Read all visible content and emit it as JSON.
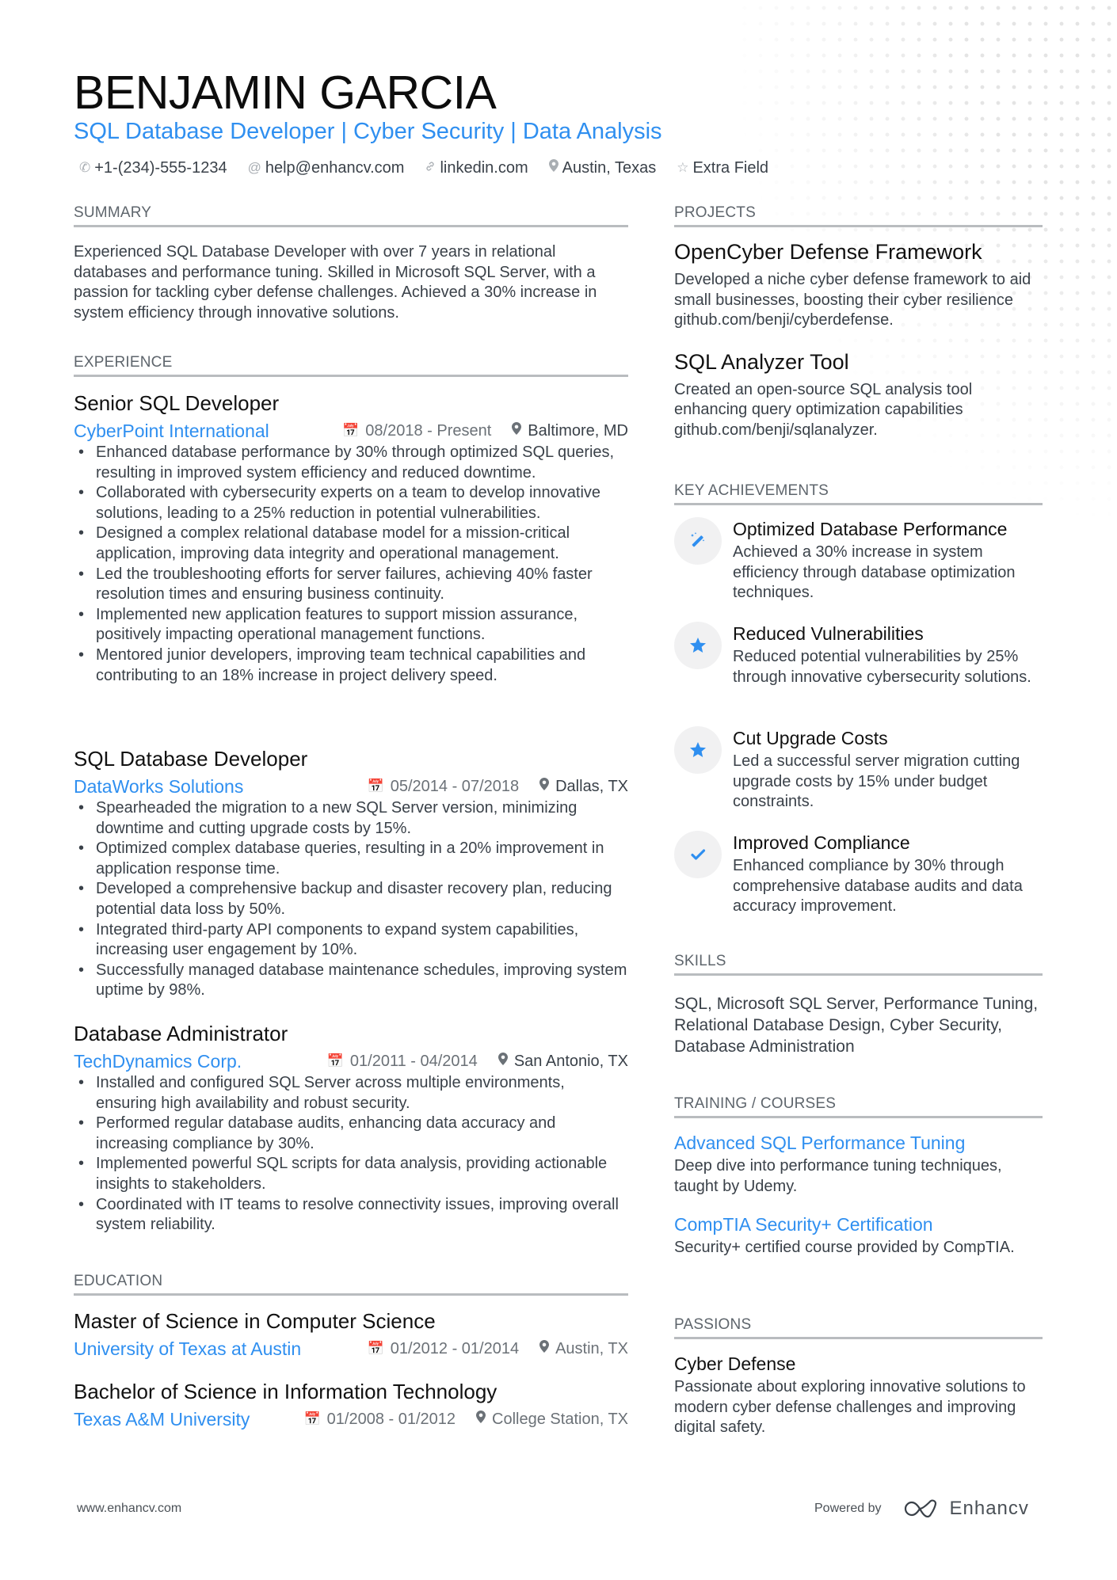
{
  "header": {
    "name": "BENJAMIN GARCIA",
    "headline": "SQL Database Developer | Cyber Security | Data Analysis",
    "contacts": [
      {
        "icon": "phone-icon",
        "text": "+1-(234)-555-1234"
      },
      {
        "icon": "at-icon",
        "text": "help@enhancv.com"
      },
      {
        "icon": "link-icon",
        "text": "linkedin.com"
      },
      {
        "icon": "location-pin-icon",
        "text": "Austin, Texas"
      },
      {
        "icon": "star-outline-icon",
        "text": "Extra Field"
      }
    ]
  },
  "summary": {
    "heading": "SUMMARY",
    "text": "Experienced SQL Database Developer with over 7 years in relational databases and performance tuning. Skilled in Microsoft SQL Server, with a passion for tackling cyber defense challenges. Achieved a 30% increase in system efficiency through innovative solutions."
  },
  "experience": {
    "heading": "EXPERIENCE",
    "jobs": [
      {
        "title": "Senior SQL Developer",
        "company": "CyberPoint International",
        "dates": "08/2018 - Present",
        "location": "Baltimore, MD",
        "bullets": [
          "Enhanced database performance by 30% through optimized SQL queries, resulting in improved system efficiency and reduced downtime.",
          "Collaborated with cybersecurity experts on a team to develop innovative solutions, leading to a 25% reduction in potential vulnerabilities.",
          "Designed a complex relational database model for a mission-critical application, improving data integrity and operational management.",
          "Led the troubleshooting efforts for server failures, achieving 40% faster resolution times and ensuring business continuity.",
          "Implemented new application features to support mission assurance, positively impacting operational management functions.",
          "Mentored junior developers, improving team technical capabilities and contributing to an 18% increase in project delivery speed."
        ]
      },
      {
        "title": "SQL Database Developer",
        "company": "DataWorks Solutions",
        "dates": "05/2014 - 07/2018",
        "location": "Dallas, TX",
        "bullets": [
          "Spearheaded the migration to a new SQL Server version, minimizing downtime and cutting upgrade costs by 15%.",
          "Optimized complex database queries, resulting in a 20% improvement in application response time.",
          "Developed a comprehensive backup and disaster recovery plan, reducing potential data loss by 50%.",
          "Integrated third-party API components to expand system capabilities, increasing user engagement by 10%.",
          "Successfully managed database maintenance schedules, improving system uptime by 98%."
        ]
      },
      {
        "title": "Database Administrator",
        "company": "TechDynamics Corp.",
        "dates": "01/2011 - 04/2014",
        "location": "San Antonio, TX",
        "bullets": [
          "Installed and configured SQL Server across multiple environments, ensuring high availability and robust security.",
          "Performed regular database audits, enhancing data accuracy and increasing compliance by 30%.",
          "Implemented powerful SQL scripts for data analysis, providing actionable insights to stakeholders.",
          "Coordinated with IT teams to resolve connectivity issues, improving overall system reliability."
        ]
      }
    ]
  },
  "education": {
    "heading": "EDUCATION",
    "items": [
      {
        "degree": "Master of Science in Computer Science",
        "school": "University of Texas at Austin",
        "dates": "01/2012 - 01/2014",
        "location": "Austin, TX"
      },
      {
        "degree": "Bachelor of Science in Information Technology",
        "school": "Texas A&M University",
        "dates": "01/2008 - 01/2012",
        "location": "College Station, TX"
      }
    ]
  },
  "projects": {
    "heading": "PROJECTS",
    "items": [
      {
        "title": "OpenCyber Defense Framework",
        "description": "Developed a niche cyber defense framework to aid small businesses, boosting their cyber resilience github.com/benji/cyberdefense."
      },
      {
        "title": "SQL Analyzer Tool",
        "description": "Created an open-source SQL analysis tool enhancing query optimization capabilities github.com/benji/sqlanalyzer."
      }
    ]
  },
  "achievements": {
    "heading": "KEY ACHIEVEMENTS",
    "items": [
      {
        "icon": "magic-wand-icon",
        "title": "Optimized Database Performance",
        "description": "Achieved a 30% increase in system efficiency through database optimization techniques."
      },
      {
        "icon": "star-icon",
        "title": "Reduced Vulnerabilities",
        "description": "Reduced potential vulnerabilities by 25% through innovative cybersecurity solutions."
      },
      {
        "icon": "star-icon",
        "title": "Cut Upgrade Costs",
        "description": "Led a successful server migration cutting upgrade costs by 15% under budget constraints."
      },
      {
        "icon": "checkmark-icon",
        "title": "Improved Compliance",
        "description": "Enhanced compliance by 30% through comprehensive database audits and data accuracy improvement."
      }
    ]
  },
  "skills": {
    "heading": "SKILLS",
    "text": "SQL, Microsoft SQL Server, Performance Tuning, Relational Database Design, Cyber Security, Database Administration"
  },
  "training": {
    "heading": "TRAINING / COURSES",
    "items": [
      {
        "title": "Advanced SQL Performance Tuning",
        "description": "Deep dive into performance tuning techniques, taught by Udemy."
      },
      {
        "title": "CompTIA Security+ Certification",
        "description": "Security+ certified course provided by CompTIA."
      }
    ]
  },
  "passions": {
    "heading": "PASSIONS",
    "items": [
      {
        "title": "Cyber Defense",
        "description": "Passionate about exploring innovative solutions to modern cyber defense challenges and improving digital safety."
      }
    ]
  },
  "footer": {
    "website": "www.enhancv.com",
    "powered_by": "Powered by",
    "brand": "Enhancv"
  },
  "colors": {
    "accent": "#2f8ff0",
    "text": "#3a4149",
    "heading": "#111111",
    "rule": "#b9bcbf"
  }
}
